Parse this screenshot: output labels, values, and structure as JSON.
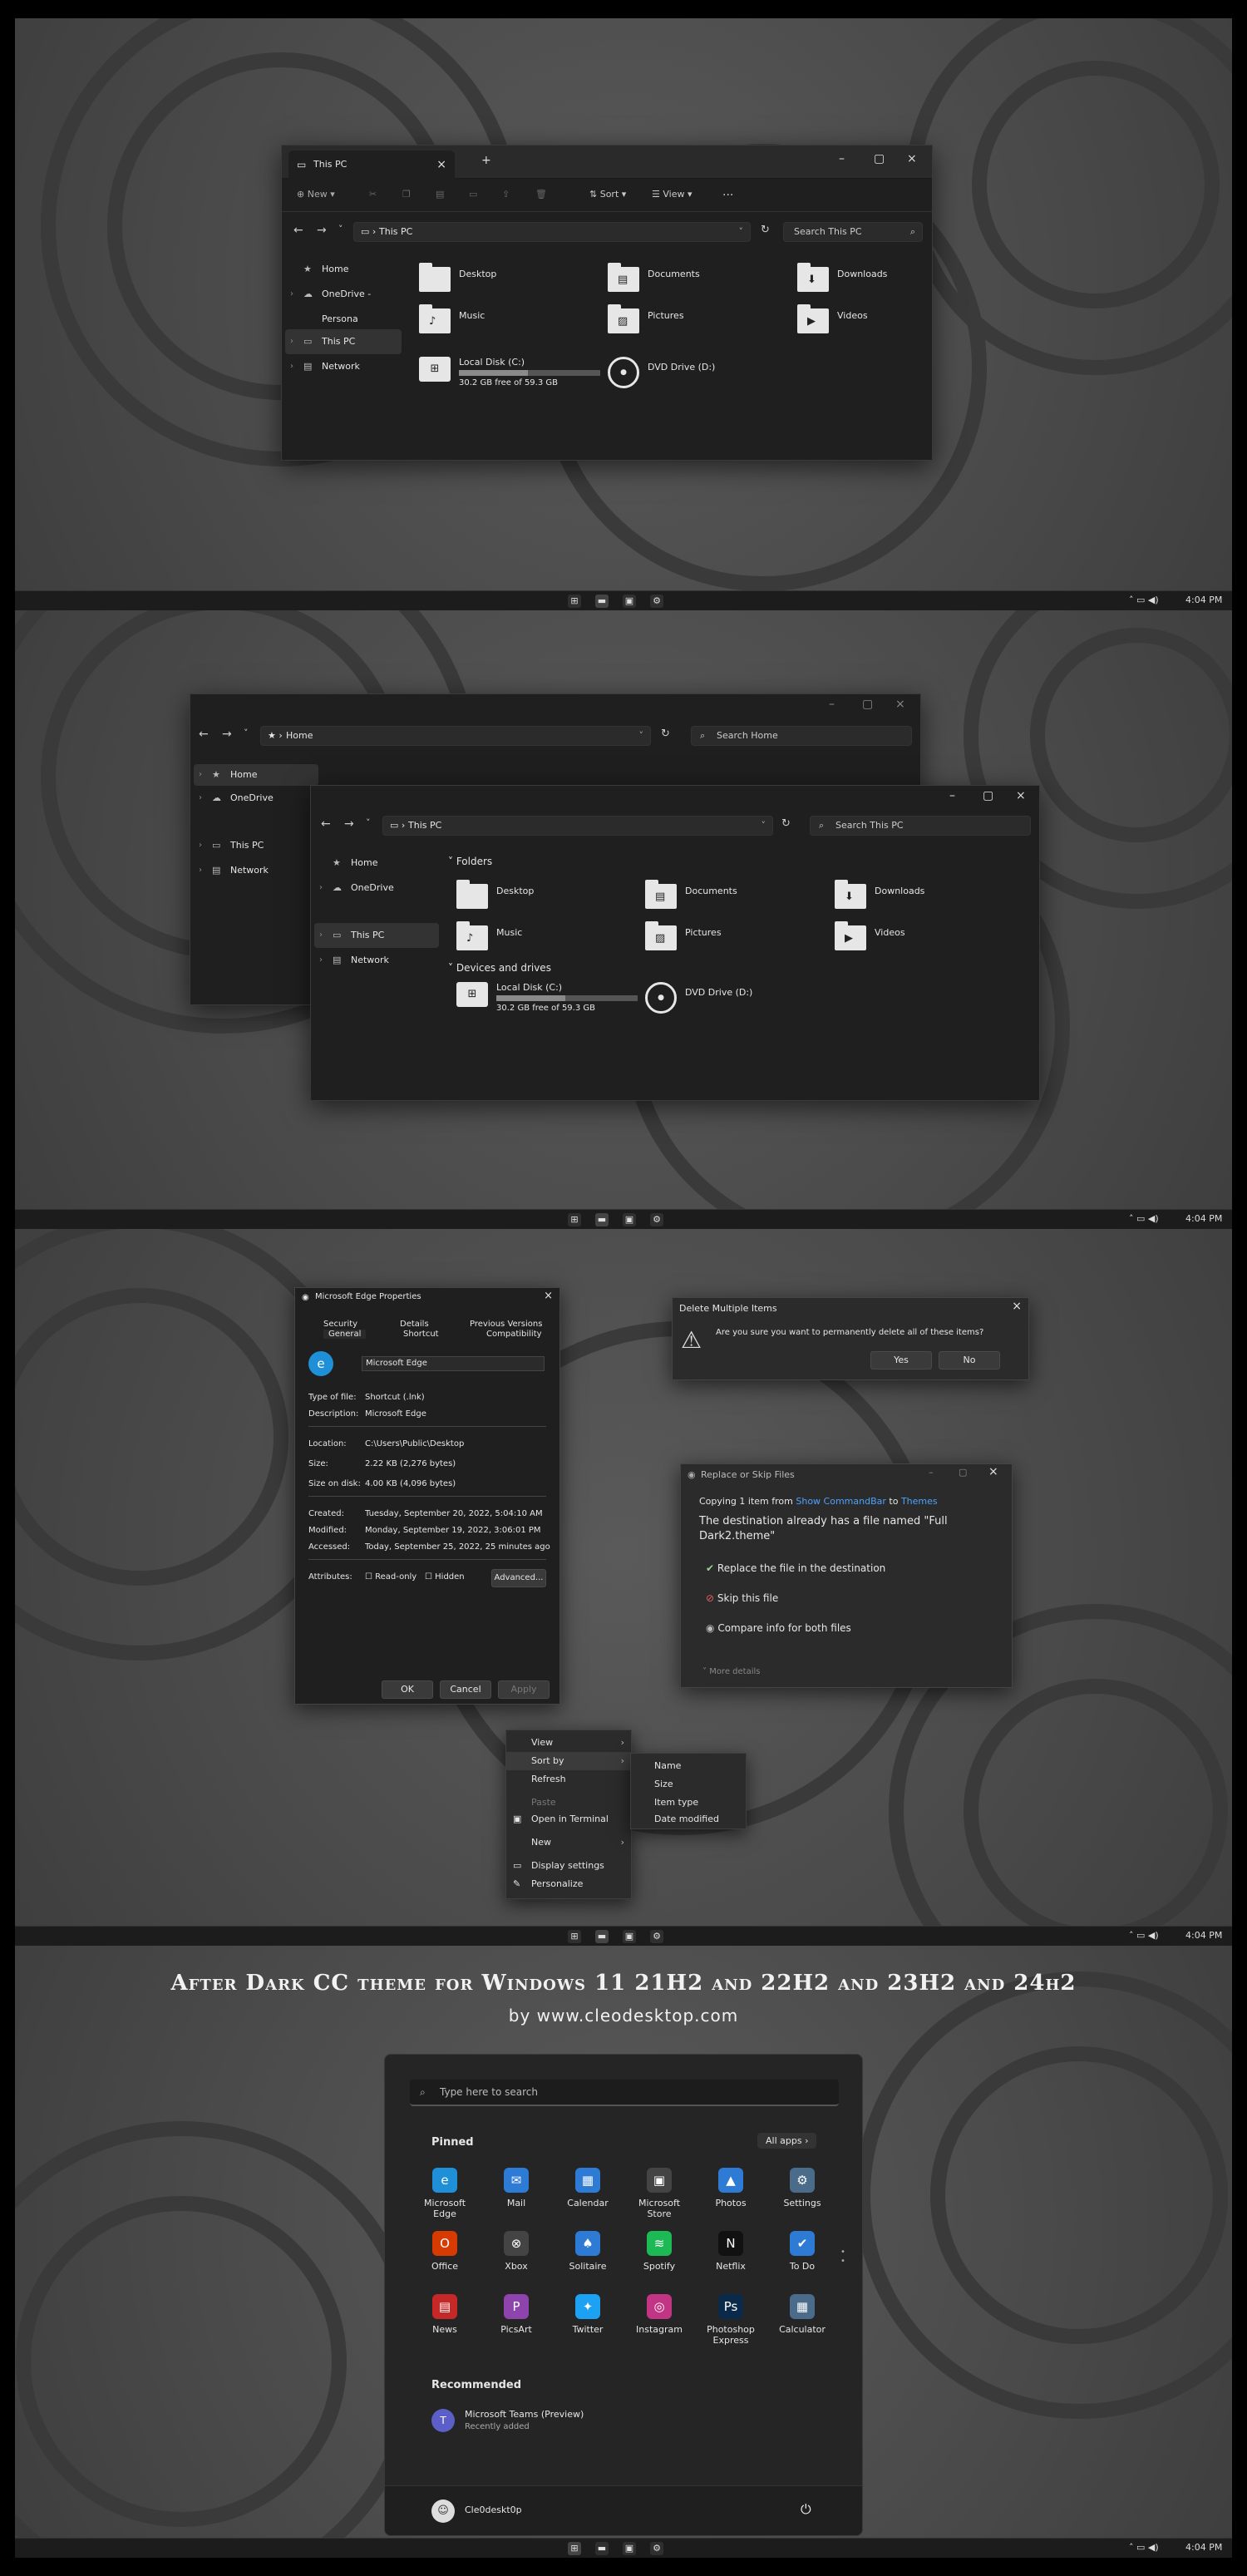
{
  "colors": {
    "accent": "#4aa3ff",
    "window": "#1f1f1f",
    "titlebar": "#2a2a2a",
    "dialog": "#2b2b2b",
    "taskbar": "#1c1c1c"
  },
  "icons": [
    "home-icon",
    "cloud-icon",
    "pc-icon",
    "network-icon",
    "folder-icon",
    "drive-icon",
    "dvd-icon",
    "search-icon",
    "refresh-icon",
    "warning-icon",
    "edge-icon",
    "gear-icon",
    "power-icon"
  ],
  "taskbar": {
    "time": "4:04 PM"
  },
  "explorer1": {
    "tab_title": "This PC",
    "new_tab": "+",
    "cmd": {
      "new": "New",
      "sort": "Sort",
      "view": "View",
      "more": "..."
    },
    "address": "This PC",
    "search_placeholder": "Search This PC",
    "sidebar": [
      "Home",
      "OneDrive - Persona",
      "This PC",
      "Network"
    ],
    "folders": [
      "Desktop",
      "Documents",
      "Downloads",
      "Music",
      "Pictures",
      "Videos"
    ],
    "drive": {
      "name": "Local Disk (C:)",
      "free": "30.2 GB free of 59.3 GB",
      "used_fraction": 0.49
    },
    "dvd": "DVD Drive (D:)"
  },
  "explorer2": {
    "back_address": "Home",
    "back_search": "Search Home",
    "back_sidebar": [
      "Home",
      "OneDrive",
      "This PC",
      "Network"
    ],
    "address": "This PC",
    "search_placeholder": "Search This PC",
    "sidebar": [
      "Home",
      "OneDrive",
      "This PC",
      "Network"
    ],
    "section_folders": "Folders",
    "section_drives": "Devices and drives",
    "folders": [
      "Desktop",
      "Documents",
      "Downloads",
      "Music",
      "Pictures",
      "Videos"
    ],
    "drive": {
      "name": "Local Disk (C:)",
      "free": "30.2 GB free of 59.3 GB",
      "used_fraction": 0.49
    },
    "dvd": "DVD Drive (D:)"
  },
  "props": {
    "title": "Microsoft Edge Properties",
    "tabs_top": [
      "Security",
      "Details",
      "Previous Versions"
    ],
    "tabs_bottom": [
      "General",
      "Shortcut",
      "Compatibility"
    ],
    "name": "Microsoft Edge",
    "rows": [
      [
        "Type of file:",
        "Shortcut (.lnk)"
      ],
      [
        "Description:",
        "Microsoft Edge"
      ],
      [
        "Location:",
        "C:\\Users\\Public\\Desktop"
      ],
      [
        "Size:",
        "2.22 KB (2,276 bytes)"
      ],
      [
        "Size on disk:",
        "4.00 KB (4,096 bytes)"
      ],
      [
        "Created:",
        "Tuesday, September 20, 2022, 5:04:10 AM"
      ],
      [
        "Modified:",
        "Monday, September 19, 2022, 3:06:01 PM"
      ],
      [
        "Accessed:",
        "Today, September 25, 2022, 25 minutes ago"
      ]
    ],
    "attributes": "Attributes:",
    "readonly": "Read-only",
    "hidden": "Hidden",
    "advanced": "Advanced...",
    "ok": "OK",
    "cancel": "Cancel",
    "apply": "Apply"
  },
  "delete_dlg": {
    "title": "Delete Multiple Items",
    "message": "Are you sure you want to permanently delete all of these items?",
    "yes": "Yes",
    "no": "No"
  },
  "replace_dlg": {
    "title": "Replace or Skip Files",
    "copy_prefix": "Copying 1 item from ",
    "copy_src": "Show CommandBar",
    "copy_mid": " to ",
    "copy_dst": "Themes",
    "heading": "The destination already has a file named \"Full Dark2.theme\"",
    "opt1": "Replace the file in the destination",
    "opt2": "Skip this file",
    "opt3": "Compare info for both files",
    "more": "More details"
  },
  "context": {
    "items": [
      "View",
      "Sort by",
      "Refresh",
      "Paste",
      "Open in Terminal",
      "New",
      "Display settings",
      "Personalize"
    ],
    "sub": [
      "Name",
      "Size",
      "Item type",
      "Date modified"
    ]
  },
  "banner": {
    "title": "After Dark CC theme for Windows 11 21H2 and 22H2 and 23H2 and 24h2",
    "sub": "by www.cleodesktop.com"
  },
  "start": {
    "search_placeholder": "Type here to search",
    "pinned": "Pinned",
    "all_apps": "All apps",
    "apps": [
      {
        "name": "Microsoft Edge",
        "color": "#1f8fd8",
        "glyph": "e"
      },
      {
        "name": "Mail",
        "color": "#2e7bd6",
        "glyph": "✉"
      },
      {
        "name": "Calendar",
        "color": "#2e7bd6",
        "glyph": "▦"
      },
      {
        "name": "Microsoft Store",
        "color": "#444",
        "glyph": "▣"
      },
      {
        "name": "Photos",
        "color": "#2e7bd6",
        "glyph": "▲"
      },
      {
        "name": "Settings",
        "color": "#4a6b8a",
        "glyph": "⚙"
      },
      {
        "name": "Office",
        "color": "#d83b01",
        "glyph": "O"
      },
      {
        "name": "Xbox",
        "color": "#444",
        "glyph": "⊗"
      },
      {
        "name": "Solitaire",
        "color": "#2e7bd6",
        "glyph": "♠"
      },
      {
        "name": "Spotify",
        "color": "#1db954",
        "glyph": "≋"
      },
      {
        "name": "Netflix",
        "color": "#111",
        "glyph": "N"
      },
      {
        "name": "To Do",
        "color": "#2e7bd6",
        "glyph": "✔"
      },
      {
        "name": "News",
        "color": "#c62828",
        "glyph": "▤"
      },
      {
        "name": "PicsArt",
        "color": "#8e44ad",
        "glyph": "P"
      },
      {
        "name": "Twitter",
        "color": "#1da1f2",
        "glyph": "✦"
      },
      {
        "name": "Instagram",
        "color": "#c13584",
        "glyph": "◎"
      },
      {
        "name": "Photoshop Express",
        "color": "#0b2a4a",
        "glyph": "Ps"
      },
      {
        "name": "Calculator",
        "color": "#4a6b8a",
        "glyph": "▦"
      }
    ],
    "recommended": "Recommended",
    "rec_title": "Microsoft Teams (Preview)",
    "rec_sub": "Recently added",
    "user": "Cle0deskt0p"
  }
}
